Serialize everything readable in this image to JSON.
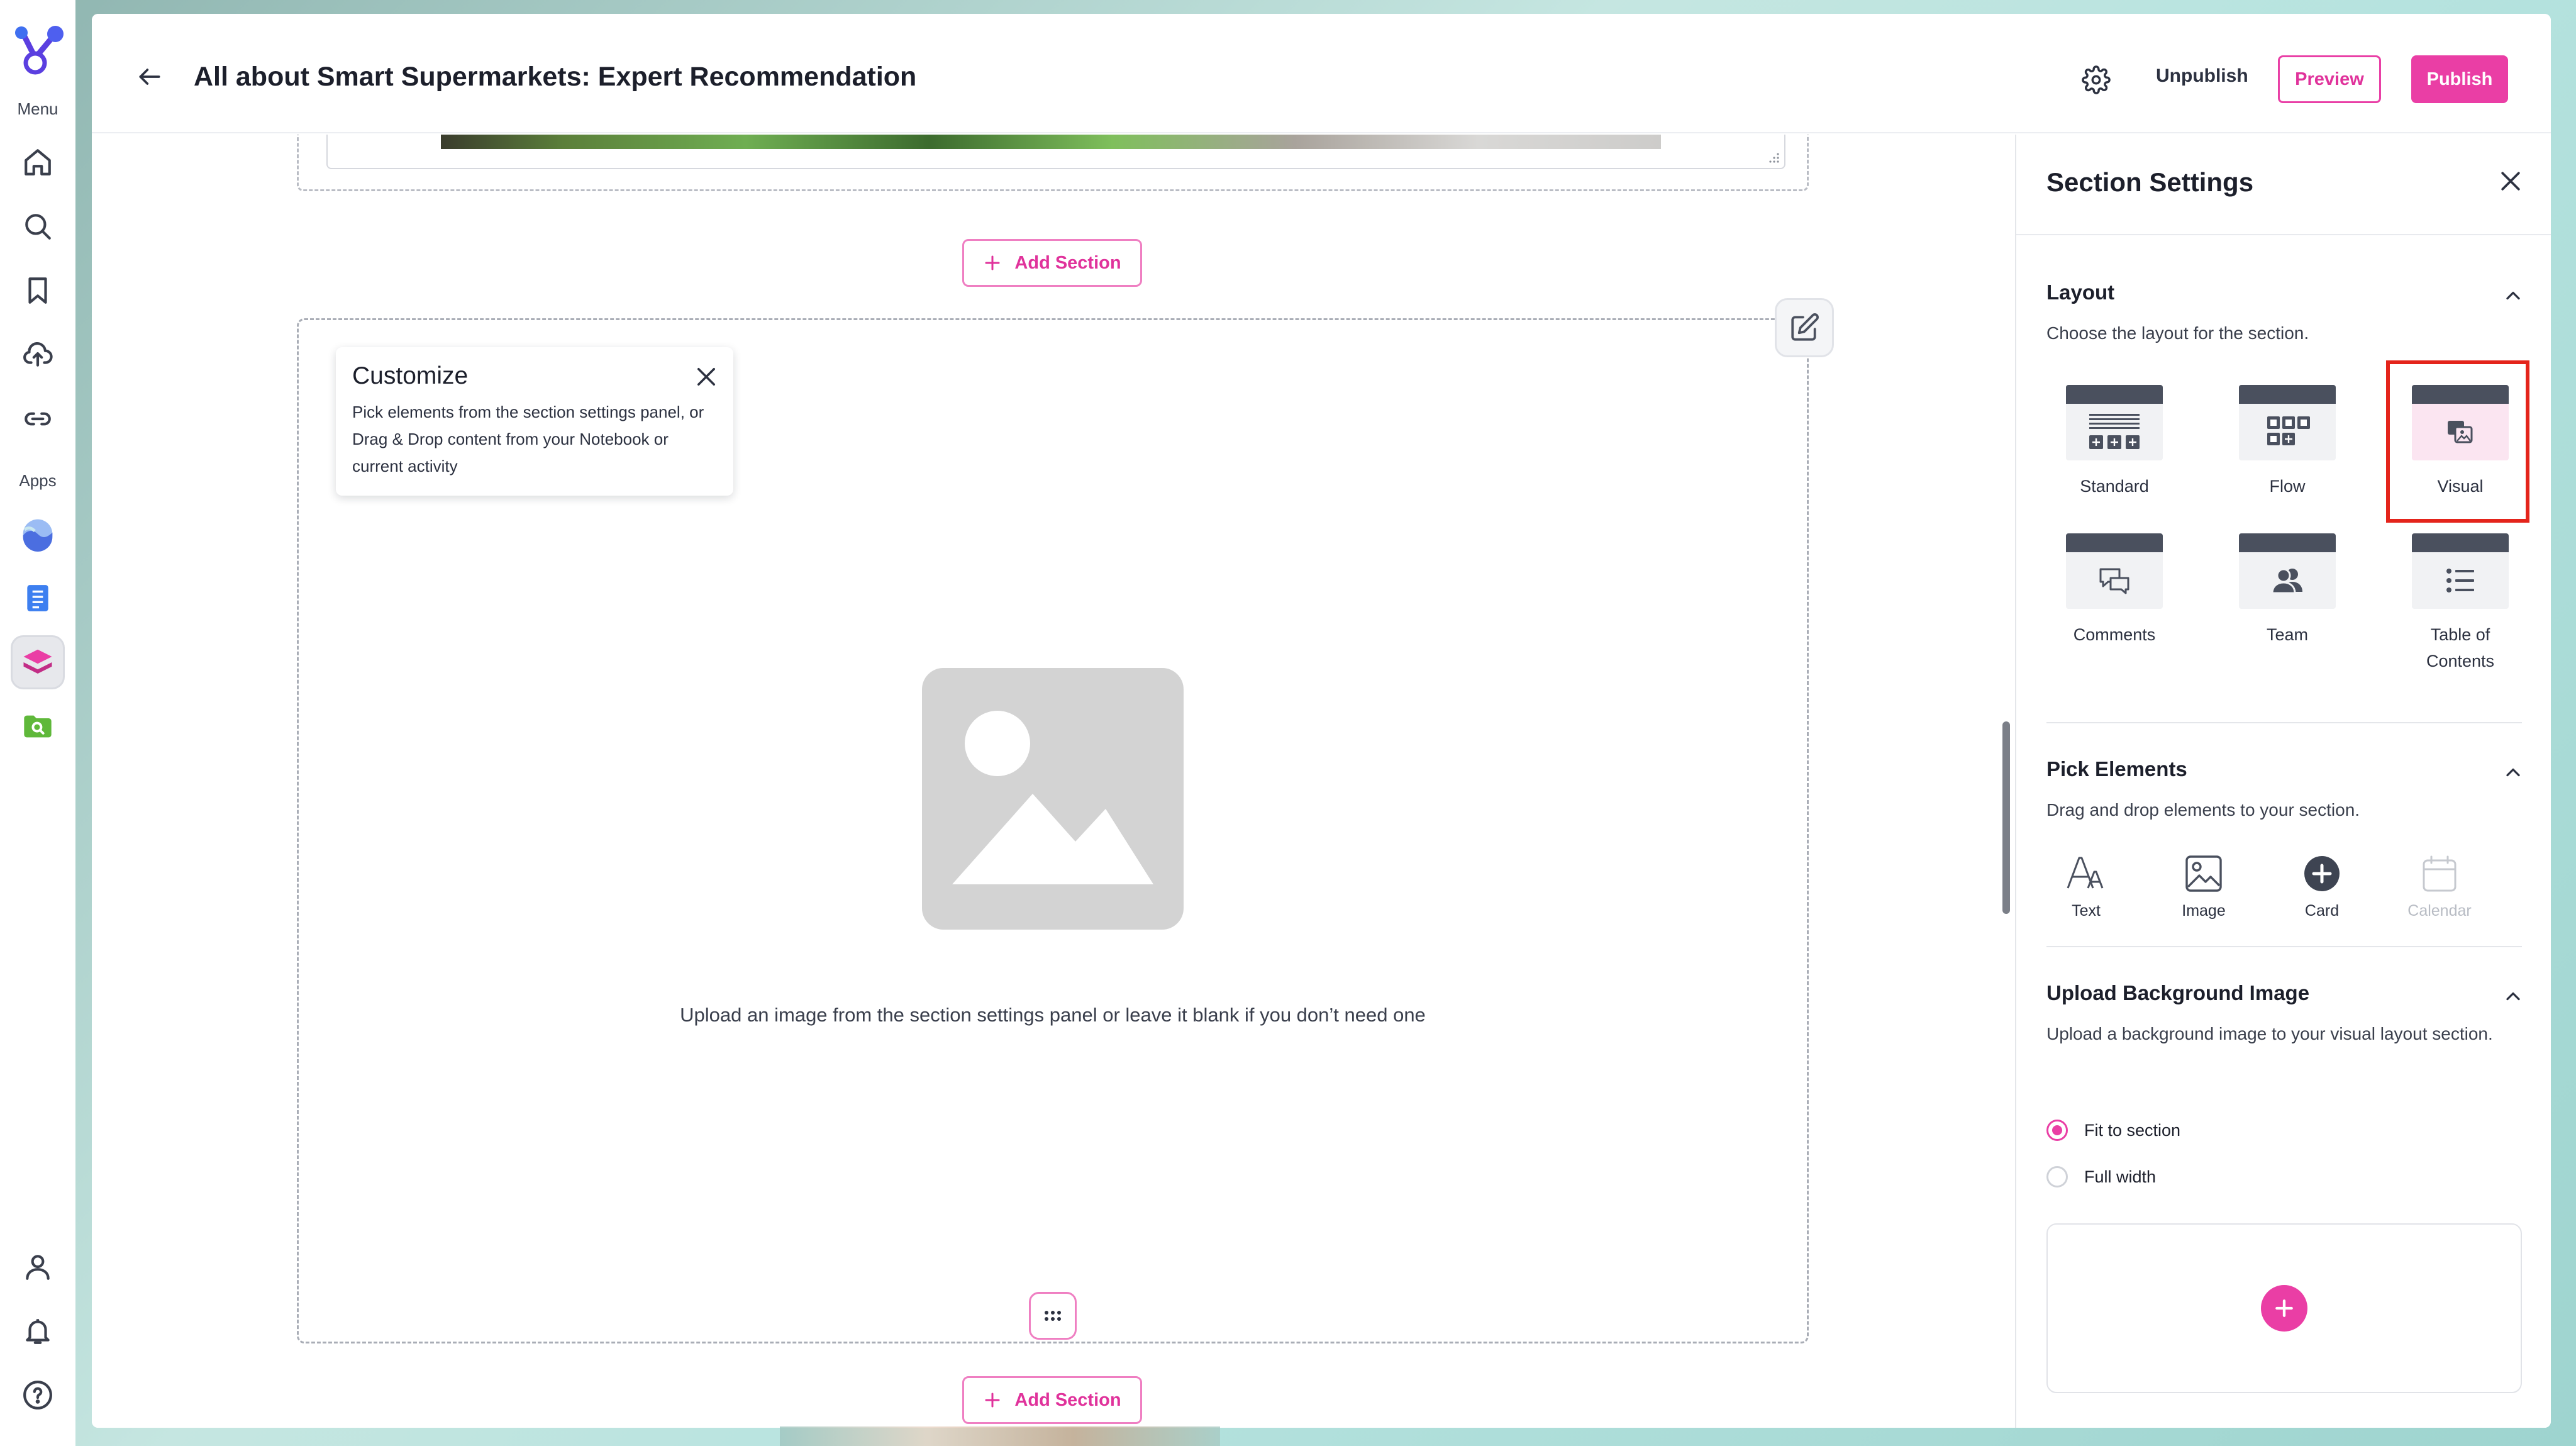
{
  "rail": {
    "menu_label": "Menu",
    "apps_label": "Apps",
    "nav_icons": [
      "home-icon",
      "search-icon",
      "bookmark-icon",
      "upload-cloud-icon",
      "link-icon"
    ],
    "app_icons": [
      "wave-app-icon",
      "document-app-icon",
      "layers-app-icon",
      "folder-search-app-icon"
    ],
    "bottom_icons": [
      "user-icon",
      "bell-icon",
      "help-icon"
    ]
  },
  "header": {
    "title": "All about Smart Supermarkets: Expert Recommendation",
    "unpublish_label": "Unpublish",
    "preview_label": "Preview",
    "publish_label": "Publish"
  },
  "canvas": {
    "add_section_label": "Add Section",
    "customize": {
      "title": "Customize",
      "body": "Pick elements from the section settings panel, or Drag & Drop content from your Notebook or current activity"
    },
    "upload_hint": "Upload an image from the section settings panel or leave it blank if you don’t need one"
  },
  "panel": {
    "title": "Section Settings",
    "layout": {
      "title": "Layout",
      "description": "Choose the layout for the section.",
      "options": [
        {
          "label": "Standard",
          "icon": "standard-layout-icon",
          "selected": false
        },
        {
          "label": "Flow",
          "icon": "flow-layout-icon",
          "selected": false
        },
        {
          "label": "Visual",
          "icon": "visual-layout-icon",
          "selected": true
        },
        {
          "label": "Comments",
          "icon": "comments-layout-icon",
          "selected": false
        },
        {
          "label": "Team",
          "icon": "team-layout-icon",
          "selected": false
        },
        {
          "label": "Table of Contents",
          "icon": "toc-layout-icon",
          "selected": false
        }
      ]
    },
    "pick_elements": {
      "title": "Pick Elements",
      "description": "Drag and drop elements to your section.",
      "items": [
        {
          "label": "Text",
          "icon": "text-icon",
          "enabled": true
        },
        {
          "label": "Image",
          "icon": "image-icon",
          "enabled": true
        },
        {
          "label": "Card",
          "icon": "card-plus-icon",
          "enabled": true
        },
        {
          "label": "Calendar",
          "icon": "calendar-icon",
          "enabled": false
        }
      ]
    },
    "background": {
      "title": "Upload Background Image",
      "description": "Upload a background image to your visual layout section.",
      "options": [
        {
          "label": "Fit to section",
          "checked": true
        },
        {
          "label": "Full width",
          "checked": false
        }
      ]
    }
  },
  "colors": {
    "accent": "#ea3ea5",
    "highlight": "#e4241b",
    "text_dark": "#1c1f2b"
  }
}
